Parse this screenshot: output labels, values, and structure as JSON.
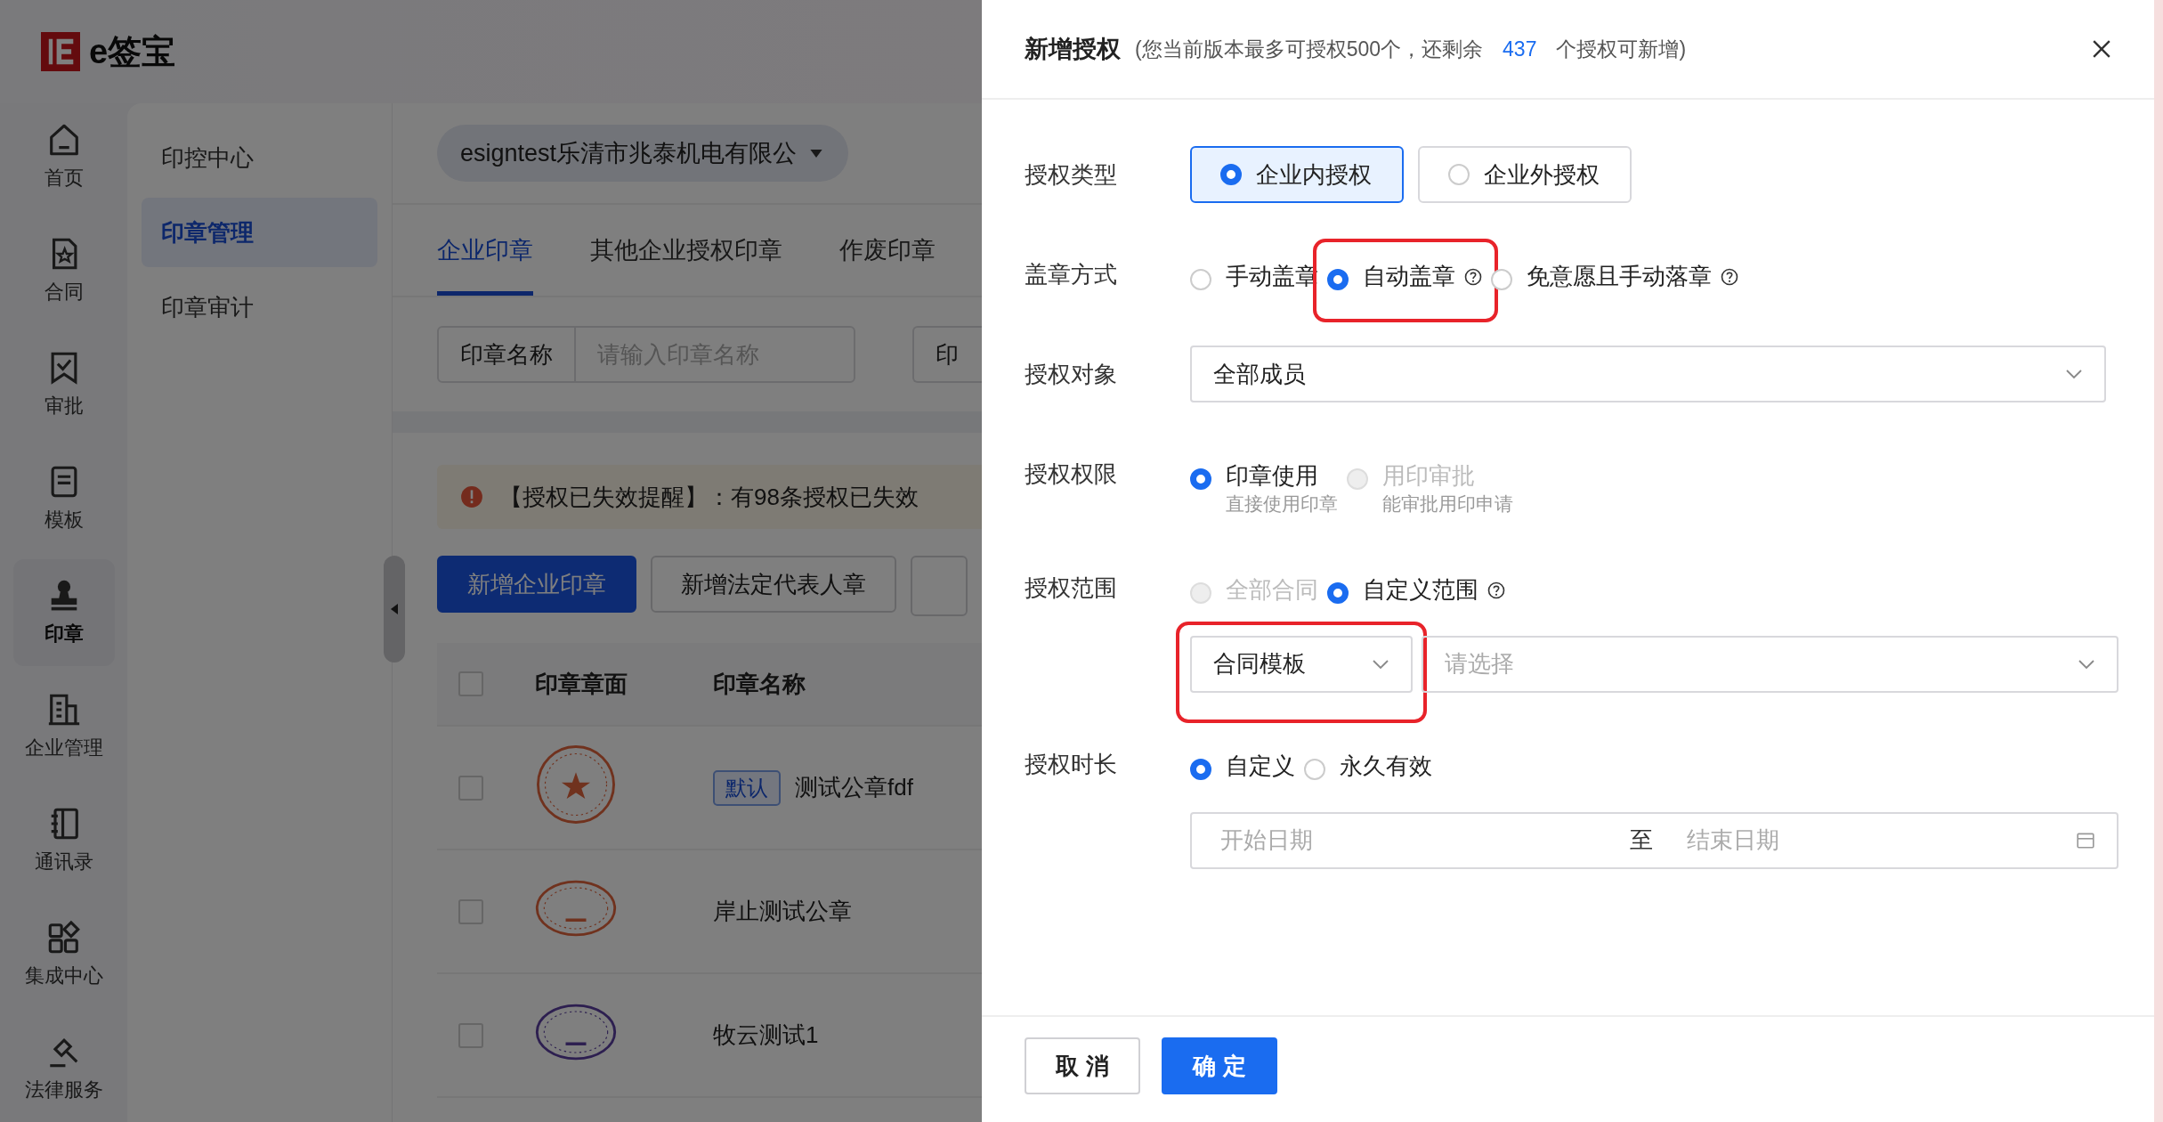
{
  "logo": {
    "text": "e签宝"
  },
  "rail": [
    {
      "label": "首页",
      "selected": false
    },
    {
      "label": "合同",
      "selected": false
    },
    {
      "label": "审批",
      "selected": false
    },
    {
      "label": "模板",
      "selected": false
    },
    {
      "label": "印章",
      "selected": true
    },
    {
      "label": "企业管理",
      "selected": false
    },
    {
      "label": "通讯录",
      "selected": false
    },
    {
      "label": "集成中心",
      "selected": false
    },
    {
      "label": "法律服务",
      "selected": false
    }
  ],
  "subnav": [
    {
      "label": "印控中心",
      "selected": false
    },
    {
      "label": "印章管理",
      "selected": true
    },
    {
      "label": "印章审计",
      "selected": false
    }
  ],
  "company": {
    "name": "esigntest乐清市兆泰机电有限公"
  },
  "tabs": [
    {
      "label": "企业印章",
      "selected": true
    },
    {
      "label": "其他企业授权印章",
      "selected": false
    },
    {
      "label": "作废印章",
      "selected": false
    }
  ],
  "filter": {
    "label": "印章名称",
    "placeholder": "请输入印章名称",
    "label_2": "印"
  },
  "alert": {
    "text": "【授权已失效提醒】：有98条授权已失效"
  },
  "actions": [
    {
      "label": "新增企业印章",
      "kind": "primary"
    },
    {
      "label": "新增法定代表人章",
      "kind": "default"
    }
  ],
  "table": {
    "columns": [
      "印章章面",
      "印章名称"
    ],
    "all_checked": false,
    "rows": [
      {
        "checked": false,
        "tag": "默认",
        "name": "测试公章fdf"
      },
      {
        "checked": false,
        "name": "岸止测试公章"
      },
      {
        "checked": false,
        "name": "牧云测试1"
      }
    ]
  },
  "drawer": {
    "title": "新增授权",
    "note": "(您当前版本最多可授权500个，还剩余",
    "count": "437",
    "note_end": "个授权可新增)",
    "fields": [
      {
        "label": "授权类型",
        "kind": "cards",
        "options": [
          {
            "label": "企业内授权",
            "selected": true
          },
          {
            "label": "企业外授权",
            "selected": false
          }
        ]
      },
      {
        "label": "盖章方式",
        "kind": "radio",
        "options": [
          {
            "label": "手动盖章",
            "selected": false,
            "disabled": false,
            "help": false
          },
          {
            "label": "自动盖章",
            "selected": true,
            "disabled": false,
            "help": true,
            "highlighted": true
          },
          {
            "label": "免意愿且手动落章",
            "selected": false,
            "disabled": false,
            "help": true
          }
        ]
      },
      {
        "label": "授权对象",
        "kind": "select",
        "value": "全部成员"
      },
      {
        "label": "授权权限",
        "kind": "radio",
        "options": [
          {
            "label": "印章使用",
            "description": "直接使用印章",
            "selected": true,
            "disabled": false,
            "help": false
          },
          {
            "label": "用印审批",
            "description": "能审批用印申请",
            "selected": false,
            "disabled": true,
            "help": false
          }
        ]
      },
      {
        "label": "授权范围",
        "kind": "radio",
        "options": [
          {
            "label": "全部合同",
            "selected": false,
            "disabled": true,
            "help": false
          },
          {
            "label": "自定义范围",
            "selected": true,
            "disabled": false,
            "help": true
          }
        ],
        "selects": [
          {
            "value": "合同模板",
            "highlighted": true
          },
          {
            "placeholder": "请选择"
          }
        ]
      },
      {
        "label": "授权时长",
        "kind": "radio",
        "options": [
          {
            "label": "自定义",
            "selected": true,
            "disabled": false,
            "help": false
          },
          {
            "label": "永久有效",
            "selected": false,
            "disabled": false,
            "help": false
          }
        ],
        "date_range": {
          "start_placeholder": "开始日期",
          "separator": "至",
          "end_placeholder": "结束日期"
        }
      }
    ],
    "buttons": [
      {
        "label": "取 消",
        "kind": "default"
      },
      {
        "label": "确 定",
        "kind": "primary"
      }
    ]
  }
}
